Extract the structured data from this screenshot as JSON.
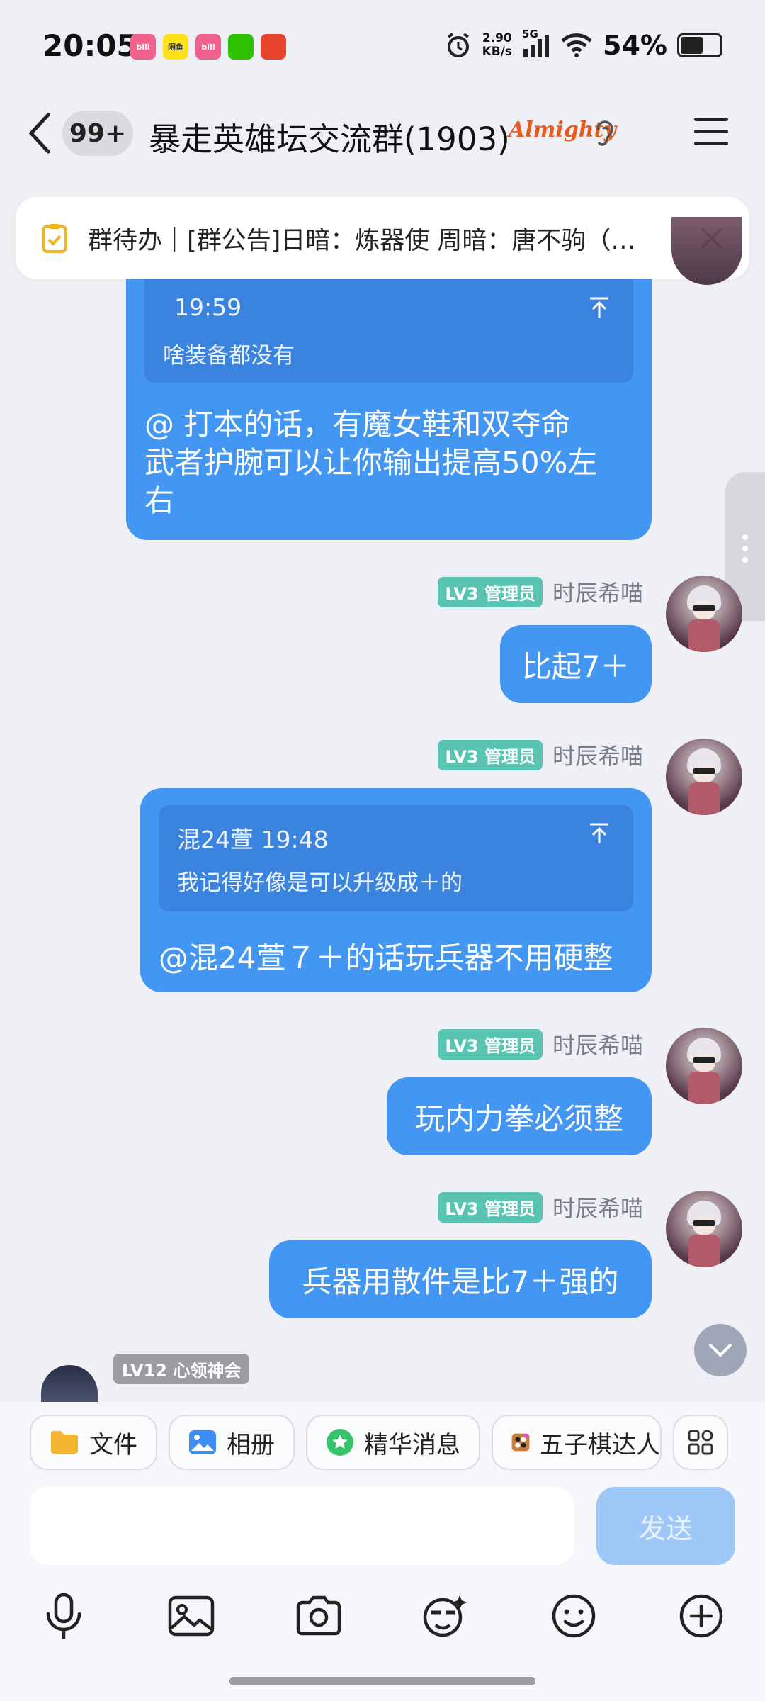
{
  "status": {
    "time": "20:05",
    "net_speed_value": "2.90",
    "net_speed_unit": "KB/s",
    "signal": "5G",
    "battery": "54%",
    "battery_level": 0.54,
    "app_icons": [
      {
        "name": "bilibili-icon",
        "label": "bili",
        "color": "#f0628e"
      },
      {
        "name": "xianyu-icon",
        "label": "闲鱼",
        "color": "#ffe21a"
      },
      {
        "name": "bilibili-icon",
        "label": "bili",
        "color": "#f0628e"
      },
      {
        "name": "wechat-icon",
        "label": "",
        "color": "#2dc100"
      },
      {
        "name": "game-icon",
        "label": "",
        "color": "#e8432c"
      }
    ]
  },
  "header": {
    "unread": "99+",
    "title": "暴走英雄坛交流群(1903)",
    "group_tag": "Almighty"
  },
  "notice": {
    "text": "群待办｜[群公告]日暗：炼器使 周暗：唐不驹（…"
  },
  "messages": [
    {
      "quote_time": "19:59",
      "quote_text": "啥装备都没有",
      "text_lines": [
        "@  打本的话，有魔女鞋和双夺命",
        "武者护腕可以让你输出提高50%左",
        "右"
      ]
    },
    {
      "badge": "LV3 管理员",
      "sender": "时辰希喵",
      "text": "比起7＋"
    },
    {
      "badge": "LV3 管理员",
      "sender": "时辰希喵",
      "quote_time": "混24萱 19:48",
      "quote_text": "我记得好像是可以升级成＋的",
      "text": "@混24萱７＋的话玩兵器不用硬整"
    },
    {
      "badge": "LV3 管理员",
      "sender": "时辰希喵",
      "text": "玩内力拳必须整"
    },
    {
      "badge": "LV3 管理员",
      "sender": "时辰希喵",
      "text": "兵器用散件是比7＋强的"
    }
  ],
  "incoming": {
    "badge": "LV12 心领神会"
  },
  "shortcuts": [
    {
      "icon": "folder-icon",
      "label": "文件"
    },
    {
      "icon": "album-icon",
      "label": "相册"
    },
    {
      "icon": "star-message-icon",
      "label": "精华消息"
    },
    {
      "icon": "gomoku-icon",
      "label": "五子棋达人"
    }
  ],
  "input": {
    "placeholder": "",
    "send_label": "发送"
  }
}
